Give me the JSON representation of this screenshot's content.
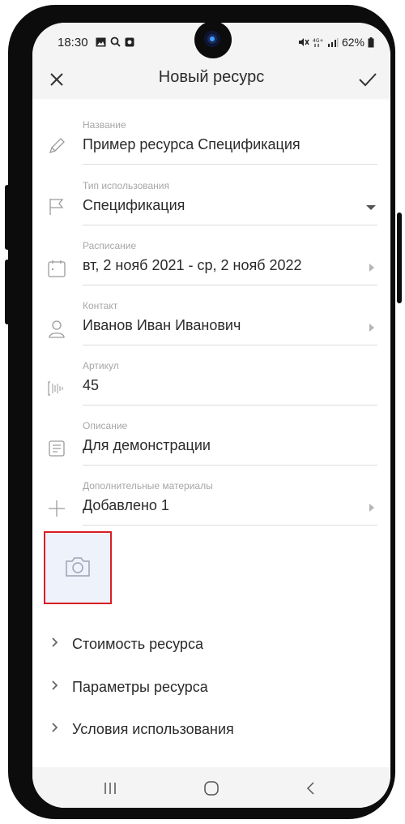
{
  "status": {
    "time": "18:30",
    "battery": "62%"
  },
  "appbar": {
    "title": "Новый ресурс",
    "close_icon": "close-icon",
    "confirm_icon": "check-icon"
  },
  "fields": [
    {
      "label": "Название",
      "value": "Пример ресурса Спецификация",
      "icon": "pencil-icon"
    },
    {
      "label": "Тип использования",
      "value": "Спецификация",
      "icon": "flag-icon"
    },
    {
      "label": "Расписание",
      "value": "вт, 2 нояб 2021 - ср, 2 нояб 2022",
      "icon": "calendar-icon"
    },
    {
      "label": "Контакт",
      "value": "Иванов Иван Иванович",
      "icon": "person-icon"
    },
    {
      "label": "Артикул",
      "value": "45",
      "icon": "barcode-icon"
    },
    {
      "label": "Описание",
      "value": "Для демонстрации",
      "icon": "document-icon"
    },
    {
      "label": "Дополнительные материалы",
      "value": "Добавлено 1",
      "icon": "plus-icon"
    }
  ],
  "photo": {
    "icon": "camera-icon"
  },
  "sections": [
    {
      "label": "Стоимость ресурса"
    },
    {
      "label": "Параметры ресурса"
    },
    {
      "label": "Условия использования"
    }
  ],
  "colors": {
    "accent_outline": "#d91e24",
    "photo_bg": "#eef2fa",
    "text": "#2b2b2b",
    "label": "#a6a6a6"
  }
}
